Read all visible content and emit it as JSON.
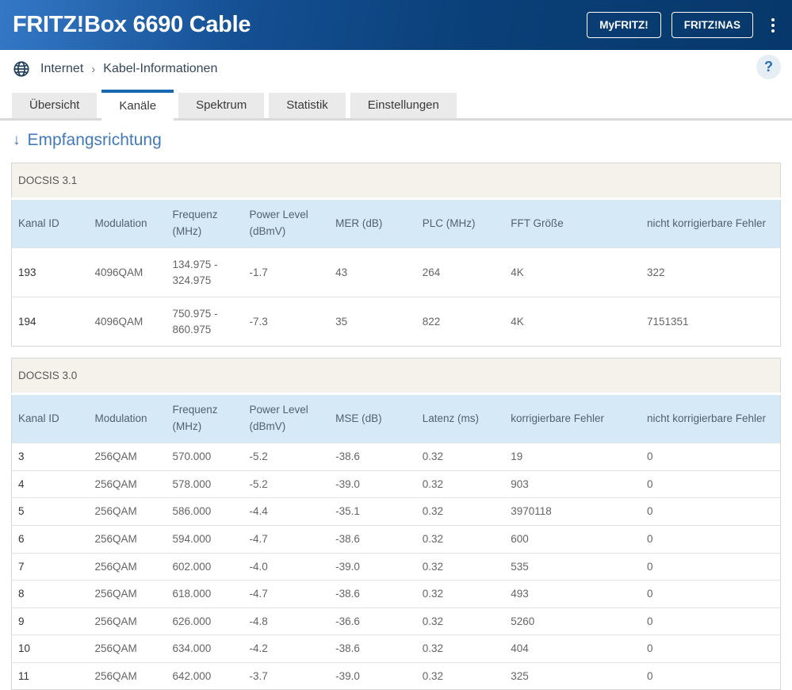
{
  "app": {
    "title": "FRITZ!Box 6690 Cable"
  },
  "header_buttons": {
    "myfritz": "MyFRITZ!",
    "fritznas": "FRITZ!NAS"
  },
  "breadcrumb": {
    "section": "Internet",
    "separator": "›",
    "page": "Kabel-Informationen"
  },
  "help": {
    "label": "?"
  },
  "tabs": {
    "t0": "Übersicht",
    "t1": "Kanäle",
    "t2": "Spektrum",
    "t3": "Statistik",
    "t4": "Einstellungen"
  },
  "section": {
    "arrow": "↓",
    "title": "Empfangsrichtung"
  },
  "tables": [
    {
      "caption": "DOCSIS 3.1",
      "columns": [
        "Kanal ID",
        "Modulation",
        "Frequenz (MHz)",
        "Power Level (dBmV)",
        "MER (dB)",
        "PLC (MHz)",
        "FFT Größe",
        "nicht korrigierbare Fehler"
      ],
      "rows": [
        [
          "193",
          "4096QAM",
          "134.975 -\n324.975",
          "-1.7",
          "43",
          "264",
          "4K",
          "322"
        ],
        [
          "194",
          "4096QAM",
          "750.975 -\n860.975",
          "-7.3",
          "35",
          "822",
          "4K",
          "7151351"
        ]
      ]
    },
    {
      "caption": "DOCSIS 3.0",
      "columns": [
        "Kanal ID",
        "Modulation",
        "Frequenz (MHz)",
        "Power Level (dBmV)",
        "MSE (dB)",
        "Latenz (ms)",
        "korrigierbare Fehler",
        "nicht korrigierbare Fehler"
      ],
      "rows": [
        [
          "3",
          "256QAM",
          "570.000",
          "-5.2",
          "-38.6",
          "0.32",
          "19",
          "0"
        ],
        [
          "4",
          "256QAM",
          "578.000",
          "-5.2",
          "-39.0",
          "0.32",
          "903",
          "0"
        ],
        [
          "5",
          "256QAM",
          "586.000",
          "-4.4",
          "-35.1",
          "0.32",
          "3970118",
          "0"
        ],
        [
          "6",
          "256QAM",
          "594.000",
          "-4.7",
          "-38.6",
          "0.32",
          "600",
          "0"
        ],
        [
          "7",
          "256QAM",
          "602.000",
          "-4.0",
          "-39.0",
          "0.32",
          "535",
          "0"
        ],
        [
          "8",
          "256QAM",
          "618.000",
          "-4.7",
          "-38.6",
          "0.32",
          "493",
          "0"
        ],
        [
          "9",
          "256QAM",
          "626.000",
          "-4.8",
          "-36.6",
          "0.32",
          "5260",
          "0"
        ],
        [
          "10",
          "256QAM",
          "634.000",
          "-4.2",
          "-38.6",
          "0.32",
          "404",
          "0"
        ],
        [
          "11",
          "256QAM",
          "642.000",
          "-3.7",
          "-39.0",
          "0.32",
          "325",
          "0"
        ]
      ]
    }
  ],
  "colors": {
    "header_gradient_start": "#3478c6",
    "header_gradient_end": "#07386b",
    "accent_blue": "#1868b4",
    "heading_blue": "#4479ba",
    "table_header_bg": "#d6e9f7",
    "caption_bg": "#f5f2ec"
  }
}
